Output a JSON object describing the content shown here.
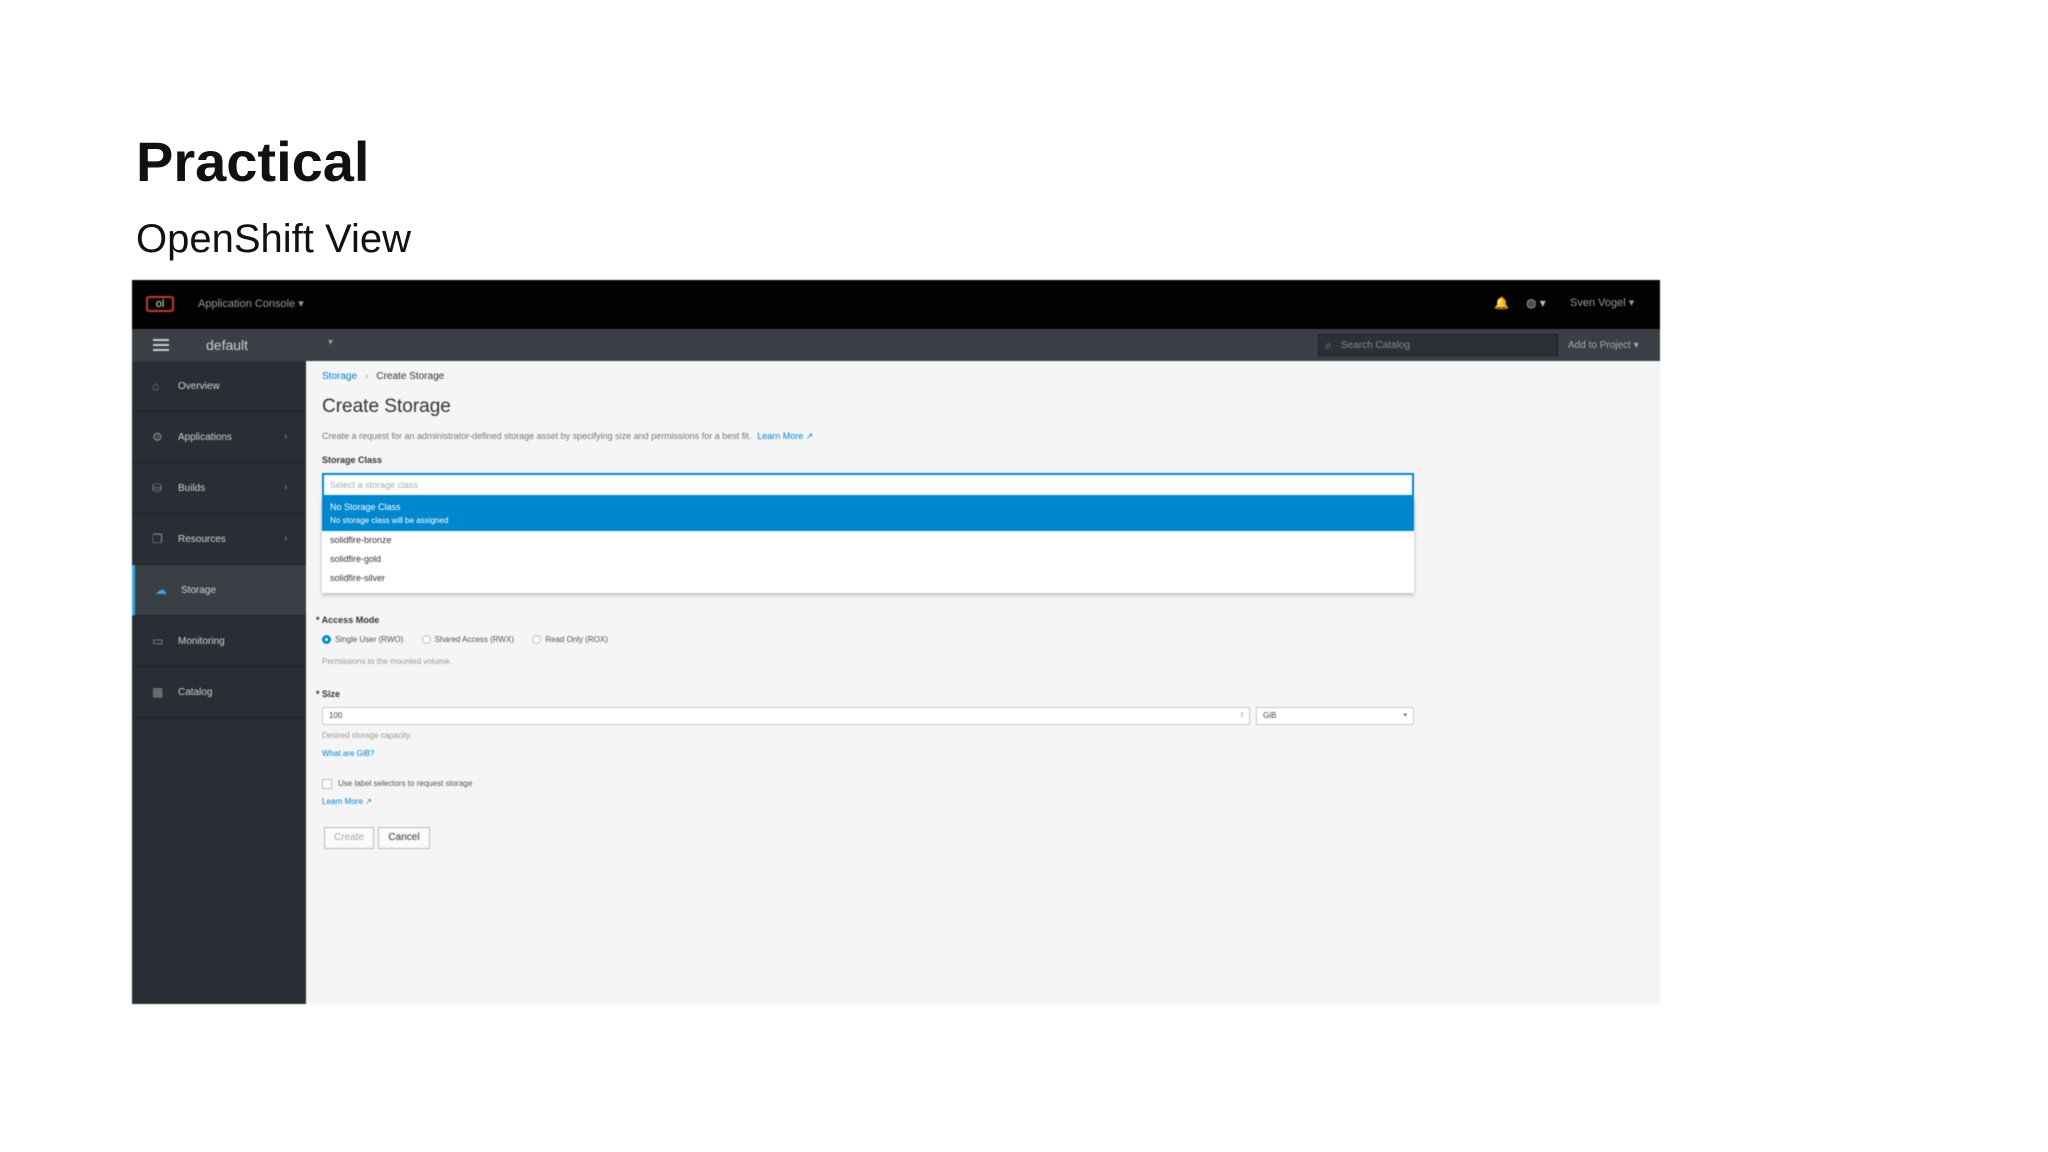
{
  "slide": {
    "title": "Practical",
    "subtitle": "OpenShift View"
  },
  "topbar": {
    "logo": "ol",
    "app_console": "Application Console ▾",
    "bell_icon": "🔔",
    "globe_icon": "◍ ▾",
    "user": "Sven Vogel ▾"
  },
  "projectbar": {
    "project": "default",
    "project_caret": "▾",
    "search_placeholder": "Search Catalog",
    "add_to_project": "Add to Project ▾"
  },
  "sidebar": {
    "items": [
      {
        "label": "Overview",
        "icon": "⌂",
        "chevron": ""
      },
      {
        "label": "Applications",
        "icon": "⚙",
        "chevron": "›"
      },
      {
        "label": "Builds",
        "icon": "⛁",
        "chevron": "›"
      },
      {
        "label": "Resources",
        "icon": "❐",
        "chevron": "›"
      },
      {
        "label": "Storage",
        "icon": "☁",
        "chevron": ""
      },
      {
        "label": "Monitoring",
        "icon": "▭",
        "chevron": ""
      },
      {
        "label": "Catalog",
        "icon": "▦",
        "chevron": ""
      }
    ],
    "active_index": 4
  },
  "main": {
    "breadcrumb": {
      "parent": "Storage",
      "separator": "›",
      "current": "Create Storage"
    },
    "title": "Create Storage",
    "description": "Create a request for an administrator-defined storage asset by specifying size and permissions for a best fit.",
    "learn_more": "Learn More ↗",
    "storage_class": {
      "label": "Storage Class",
      "placeholder": "Select a storage class",
      "options": [
        {
          "label": "No Storage Class",
          "hint": "No storage class will be assigned",
          "selected": true
        },
        {
          "label": "solidfire-bronze"
        },
        {
          "label": "solidfire-gold"
        },
        {
          "label": "solidfire-silver"
        }
      ]
    },
    "access_mode": {
      "label": "* Access Mode",
      "options": [
        "Single User (RWO)",
        "Shared Access (RWX)",
        "Read Only (ROX)"
      ],
      "selected": "Single User (RWO)",
      "help": "Permissions to the mounted volume."
    },
    "size": {
      "label": "* Size",
      "value": "100",
      "stepper": "⇕",
      "unit": "GiB",
      "unit_caret": "▾",
      "help": "Desired storage capacity.",
      "what_link": "What are GiB?"
    },
    "label_selector": {
      "label": "Use label selectors to request storage",
      "learn_more": "Learn More ↗"
    },
    "buttons": {
      "create": "Create",
      "cancel": "Cancel"
    }
  },
  "colors": {
    "accent": "#0088ce",
    "topbar": "#030303",
    "sidebar": "#292e34"
  }
}
